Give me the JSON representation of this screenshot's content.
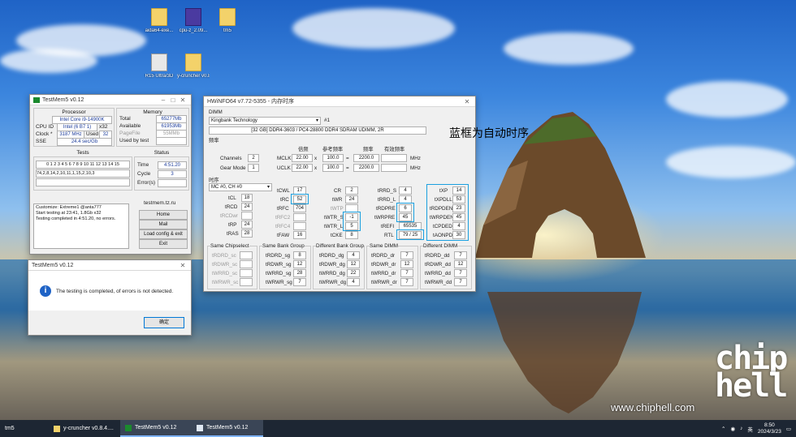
{
  "desktop": {
    "icons": [
      "aida64-exe...",
      "cpu-z_2.09...",
      "tm5",
      "R15 Ultra/3D",
      "y-cruncher v0.8.4.9538"
    ]
  },
  "testmem": {
    "title": "TestMem5 v0.12",
    "processor": {
      "heading": "Processor",
      "name": "Intel Core i9-14900K",
      "cpu_id_label": "CPU ID",
      "cpu_id": "Intel (6 B7 1)",
      "cpu_id_x": "x32",
      "clock_label": "Clock *",
      "clock": "3187 MHz",
      "used_label": "Used",
      "used": "32",
      "sse_label": "SSE",
      "sse": "24.4 sec/Gb"
    },
    "memory": {
      "heading": "Memory",
      "total_label": "Total",
      "total": "65277Mb",
      "available_label": "Available",
      "available": "61953Mb",
      "pagefile_label": "PageFile",
      "pagefile": "55MMb",
      "used_by_test_label": "Used by test",
      "used_by_test": ""
    },
    "tests": {
      "heading": "Tests",
      "numbers": "0 1 2 3 4 5 6 7 8 9 10 11 12 13 14 15",
      "sequence": "74,2,8,14,2,10,11,1,15,2,10,3"
    },
    "status": {
      "heading": "Status",
      "time_label": "Time",
      "time": "4:51.20",
      "cycle_label": "Cycle",
      "cycle": "3",
      "errors_label": "Error(s)",
      "errors": ""
    },
    "log": [
      "Customize: Extreme1 @anta777",
      "Start testing at 23:41, 1.8Gb x32",
      "Testing completed in 4:51.20, no errors."
    ],
    "site": "testmem.tz.ru",
    "buttons": {
      "home": "Home",
      "mail": "Mail",
      "load": "Load config & exit",
      "exit": "Exit"
    }
  },
  "dialog": {
    "title": "TestMem5 v0.12",
    "message": "The testing is completed, of errors is not detected.",
    "ok": "确定"
  },
  "hwinfo": {
    "title": "HWiNFO64 v7.72-5355 - 内存时序",
    "dimm_label": "DIMM",
    "dimm_select": "Kingbank Technology",
    "dimm_slot": "#1",
    "dimm_desc": "[32 GB] DDR4-3603 / PC4-28800 DDR4 SDRAM UDIMM, 2R",
    "freq_heading": "频率",
    "freq_cols": [
      "倍频",
      "参考频率",
      "频率",
      "有效频率"
    ],
    "channels_label": "Channels",
    "channels": "2",
    "gear_label": "Gear Mode",
    "gear": "1",
    "mclk_label": "MCLK",
    "mclk_mult": "22.00",
    "mclk_ref": "100.0",
    "mclk_freq": "2200.0",
    "mclk_eff": "",
    "mclk_unit": "MHz",
    "uclk_label": "UCLK",
    "uclk_mult": "22.00",
    "uclk_ref": "100.0",
    "uclk_freq": "2200.0",
    "uclk_eff": "",
    "uclk_unit": "MHz",
    "x_sign": "x",
    "eq_sign": "=",
    "timing_heading": "时序",
    "mc_select": "MC #0, CH #0",
    "col1": [
      {
        "l": "tCL",
        "v": "18"
      },
      {
        "l": "tRCD",
        "v": "24"
      },
      {
        "l": "tRCDwr",
        "v": ""
      },
      {
        "l": "tRP",
        "v": "24"
      },
      {
        "l": "tRAS",
        "v": "28"
      }
    ],
    "col2": [
      {
        "l": "tCWL",
        "v": "17"
      },
      {
        "l": "tRC",
        "v": "52"
      },
      {
        "l": "tRFC",
        "v": "704"
      },
      {
        "l": "tRFC2",
        "v": ""
      },
      {
        "l": "tRFC4",
        "v": ""
      },
      {
        "l": "tFAW",
        "v": "16"
      }
    ],
    "col3": [
      {
        "l": "CR",
        "v": "2"
      },
      {
        "l": "tWR",
        "v": "24"
      },
      {
        "l": "tWTP",
        "v": ""
      },
      {
        "l": "tWTR_S",
        "v": "-1"
      },
      {
        "l": "tWTR_L",
        "v": "5"
      },
      {
        "l": "tCKE",
        "v": "8"
      }
    ],
    "col4": [
      {
        "l": "tRRD_S",
        "v": "4"
      },
      {
        "l": "tRRD_L",
        "v": "4"
      },
      {
        "l": "tRDPRE",
        "v": "6"
      },
      {
        "l": "tWRPRE",
        "v": "45"
      },
      {
        "l": "tREFI",
        "v": "65535"
      },
      {
        "l": "RTL",
        "v": "79 / 25"
      }
    ],
    "col5": [
      {
        "l": "tXP",
        "v": "14"
      },
      {
        "l": "tXPDLL",
        "v": "53"
      },
      {
        "l": "tRDPDEN",
        "v": "23"
      },
      {
        "l": "tWRPDEN",
        "v": "45"
      },
      {
        "l": "tCPDED",
        "v": "4"
      },
      {
        "l": "tAONPD",
        "v": "30"
      }
    ],
    "groups": [
      {
        "title": "Same Chipselect",
        "rows": [
          {
            "l": "tRDRD_sc",
            "v": ""
          },
          {
            "l": "tRDWR_sc",
            "v": ""
          },
          {
            "l": "tWRRD_sc",
            "v": ""
          },
          {
            "l": "tWRWR_sc",
            "v": ""
          }
        ]
      },
      {
        "title": "Same Bank Group",
        "rows": [
          {
            "l": "tRDRD_sg",
            "v": "8"
          },
          {
            "l": "tRDWR_sg",
            "v": "12"
          },
          {
            "l": "tWRRD_sg",
            "v": "28"
          },
          {
            "l": "tWRWR_sg",
            "v": "7"
          }
        ]
      },
      {
        "title": "Different Bank Group",
        "rows": [
          {
            "l": "tRDRD_dg",
            "v": "4"
          },
          {
            "l": "tRDWR_dg",
            "v": "12"
          },
          {
            "l": "tWRRD_dg",
            "v": "22"
          },
          {
            "l": "tWRWR_dg",
            "v": "4"
          }
        ]
      },
      {
        "title": "Same DIMM",
        "rows": [
          {
            "l": "tRDRD_dr",
            "v": "7"
          },
          {
            "l": "tRDWR_dr",
            "v": "12"
          },
          {
            "l": "tWRRD_dr",
            "v": "7"
          },
          {
            "l": "tWRWR_dr",
            "v": "7"
          }
        ]
      },
      {
        "title": "Different DIMM",
        "rows": [
          {
            "l": "tRDRD_dd",
            "v": "7"
          },
          {
            "l": "tRDWR_dd",
            "v": "12"
          },
          {
            "l": "tWRRD_dd",
            "v": "7"
          },
          {
            "l": "tWRWR_dd",
            "v": "7"
          }
        ]
      }
    ]
  },
  "annotation": "蓝框为自动时序",
  "watermark": "www.chiphell.com",
  "logo_text": "chip\nhell",
  "taskbar": {
    "items": [
      "tm5",
      "y-cruncher v0.8.4....",
      "TestMem5 v0.12",
      "TestMem5 v0.12"
    ],
    "tray_lang": "英",
    "time": "8:50",
    "date": "2024/3/23"
  },
  "colors": {
    "accent": "#1ba0e0",
    "taskbar": "#1d2633",
    "testmem_icon": "#1b8a2d"
  }
}
